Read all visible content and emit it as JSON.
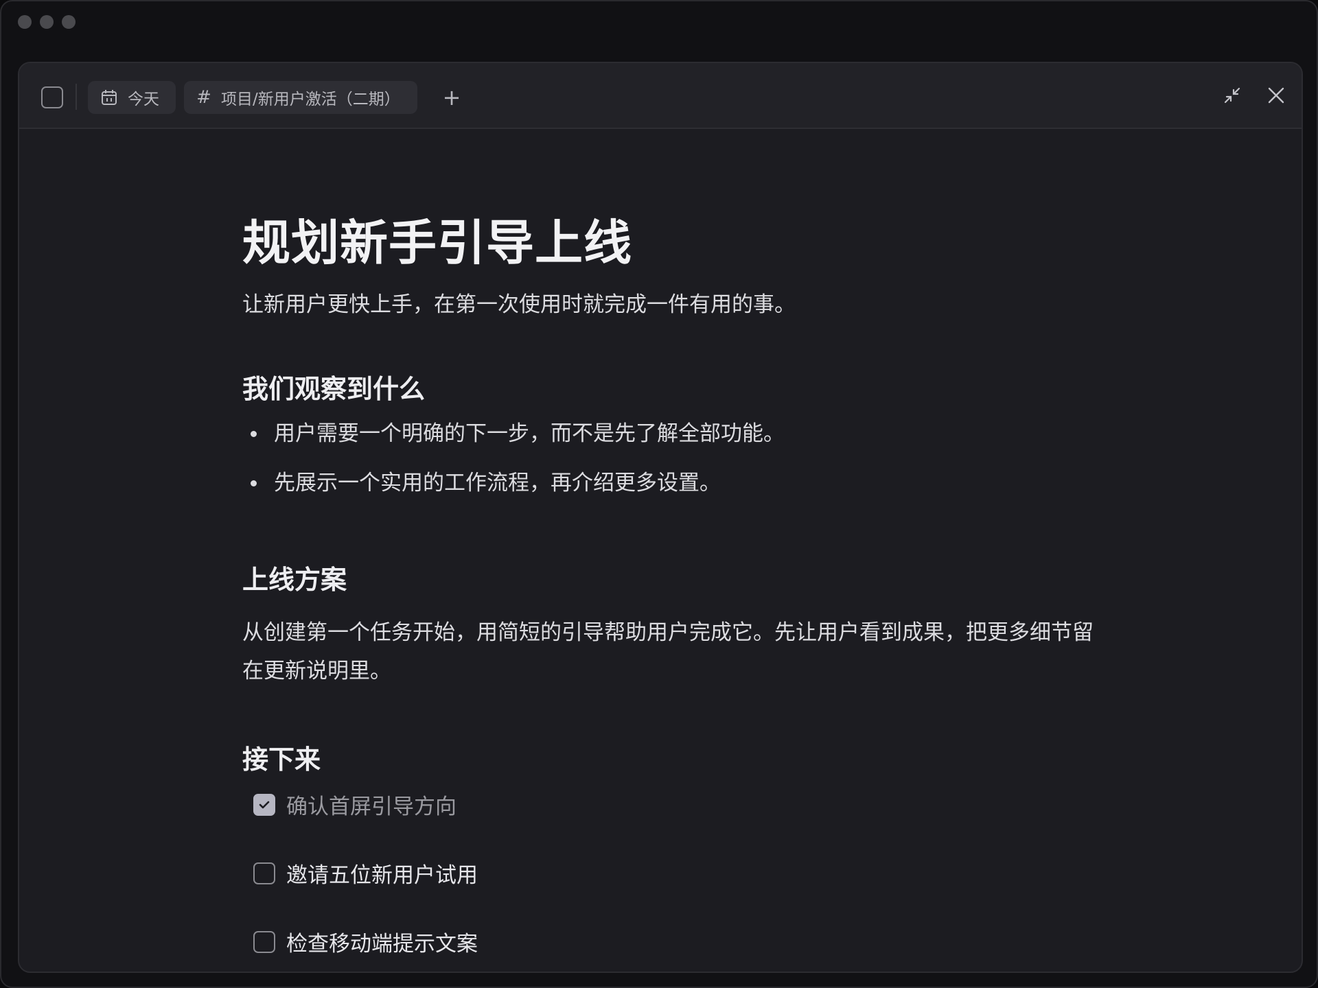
{
  "toolbar": {
    "today_label": "今天",
    "project_label": "项目/新用户激活（二期）",
    "add_tab": "+"
  },
  "doc": {
    "title": "规划新手引导上线",
    "lead": "让新用户更快上手，在第一次使用时就完成一件有用的事。",
    "observe_heading": "我们观察到什么",
    "observations": [
      "用户需要一个明确的下一步，而不是先了解全部功能。",
      "先展示一个实用的工作流程，再介绍更多设置。"
    ],
    "plan_heading": "上线方案",
    "plan_text": "从创建第一个任务开始，用简短的引导帮助用户完成它。先让用户看到成果，把更多细节留在更新说明里。",
    "next_heading": "接下来",
    "tasks": [
      {
        "label": "确认首屏引导方向",
        "checked": true
      },
      {
        "label": "邀请五位新用户试用",
        "checked": false
      },
      {
        "label": "检查移动端提示文案",
        "checked": false
      }
    ]
  }
}
